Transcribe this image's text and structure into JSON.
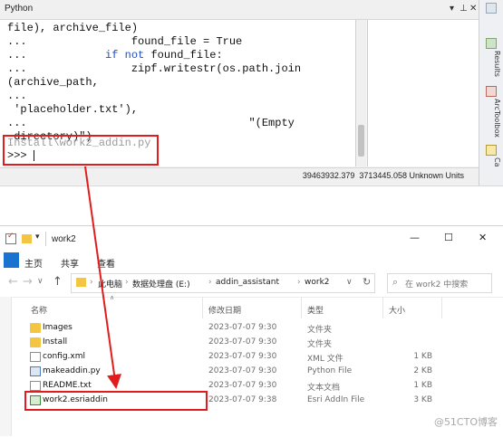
{
  "python_window": {
    "title": "Python",
    "title_buttons": [
      "▾",
      "⊥",
      "✕"
    ],
    "console_lines": [
      {
        "segments": [
          {
            "text": "file), archive_file)",
            "kind": "code"
          }
        ]
      },
      {
        "segments": [
          {
            "text": "...                found_file = True",
            "kind": "code"
          }
        ]
      },
      {
        "segments": [
          {
            "text": "...            ",
            "kind": "code"
          },
          {
            "text": "if not",
            "kind": "keyword"
          },
          {
            "text": " found_file:",
            "kind": "code"
          }
        ]
      },
      {
        "segments": [
          {
            "text": "...                zipf.writestr(os.path.join",
            "kind": "code"
          }
        ]
      },
      {
        "segments": [
          {
            "text": "(archive_path,",
            "kind": "code"
          }
        ]
      },
      {
        "segments": [
          {
            "text": "...",
            "kind": "code"
          }
        ]
      },
      {
        "segments": [
          {
            "text": " 'placeholder.txt'),",
            "kind": "code"
          }
        ]
      },
      {
        "segments": [
          {
            "text": "...                                  \"(Empty",
            "kind": "code"
          }
        ]
      },
      {
        "segments": [
          {
            "text": " directory)\")",
            "kind": "code"
          }
        ]
      }
    ],
    "command_line": "Install\\work2_addin.py",
    "prompt": ">>> ",
    "status": "39463932.379  3713445.058 Unknown Units",
    "side_tabs": [
      "Results",
      "ArcToolbox",
      "Ca"
    ]
  },
  "explorer_window": {
    "title": "work2",
    "title_controls": [
      "—",
      "☐",
      "✕"
    ],
    "ribbon_tabs": [
      "主页",
      "共享",
      "查看"
    ],
    "breadcrumb": [
      "此电脑",
      "数据处理盘 (E:)",
      "addin_assistant",
      "work2"
    ],
    "search_placeholder": "在 work2 中搜索",
    "columns": {
      "name": "名称",
      "modified": "修改日期",
      "type": "类型",
      "size": "大小"
    },
    "files": [
      {
        "name": "Images",
        "modified": "2023-07-07 9:30",
        "type": "文件夹",
        "size": "",
        "icon": "folder-icon"
      },
      {
        "name": "Install",
        "modified": "2023-07-07 9:30",
        "type": "文件夹",
        "size": "",
        "icon": "folder-icon"
      },
      {
        "name": "config.xml",
        "modified": "2023-07-07 9:30",
        "type": "XML 文件",
        "size": "1 KB",
        "icon": "xml-file-icon"
      },
      {
        "name": "makeaddin.py",
        "modified": "2023-07-07 9:30",
        "type": "Python File",
        "size": "2 KB",
        "icon": "python-file-icon"
      },
      {
        "name": "README.txt",
        "modified": "2023-07-07 9:30",
        "type": "文本文档",
        "size": "1 KB",
        "icon": "text-file-icon"
      },
      {
        "name": "work2.esriaddin",
        "modified": "2023-07-07 9:38",
        "type": "Esri AddIn File",
        "size": "3 KB",
        "icon": "esri-addin-icon"
      }
    ]
  },
  "watermark": "@51CTO博客",
  "colors": {
    "highlight_red": "#e21c1c",
    "keyword_blue": "#1f4fc8",
    "file_tab_blue": "#1a73d1",
    "folder_yellow": "#f4c542"
  }
}
